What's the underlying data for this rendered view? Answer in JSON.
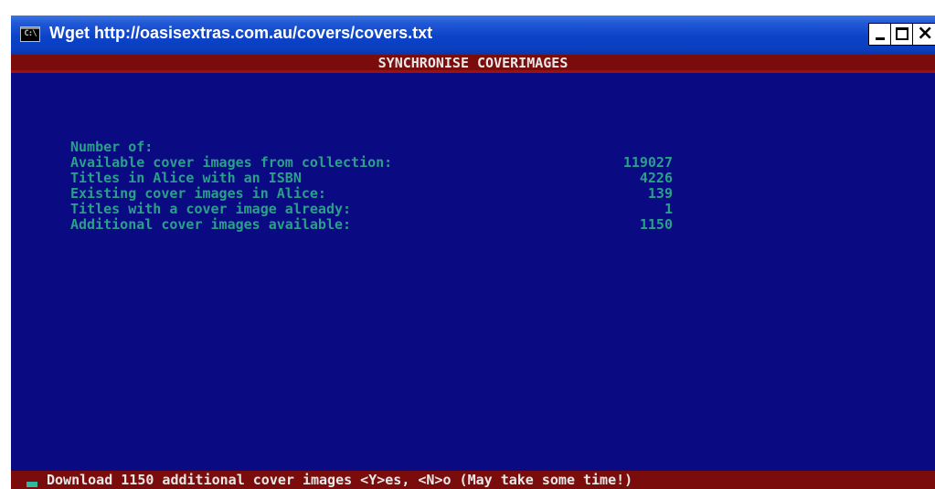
{
  "window": {
    "title": "Wget http://oasisextras.com.au/covers/covers.txt",
    "icon_text": "C:\\"
  },
  "screen": {
    "header": "SYNCHRONISE COVERIMAGES",
    "stats": {
      "heading": "Number of:",
      "rows": [
        {
          "label": "Available cover images from collection:",
          "value": "119027"
        },
        {
          "label": "Titles in Alice with an ISBN",
          "value": "4226"
        },
        {
          "label": "Existing cover images in Alice:",
          "value": "139"
        },
        {
          "label": "Titles with a cover image already:",
          "value": "1"
        },
        {
          "label": "Additional cover images available:",
          "value": "1150"
        }
      ]
    },
    "prompt": "Download 1150 additional cover images <Y>es, <N>o (May take some time!)"
  },
  "colors": {
    "console_bg": "#0a0a82",
    "bar_bg": "#7a0c0c",
    "text_teal": "#2aa08a",
    "text_light": "#e8e8e8"
  }
}
